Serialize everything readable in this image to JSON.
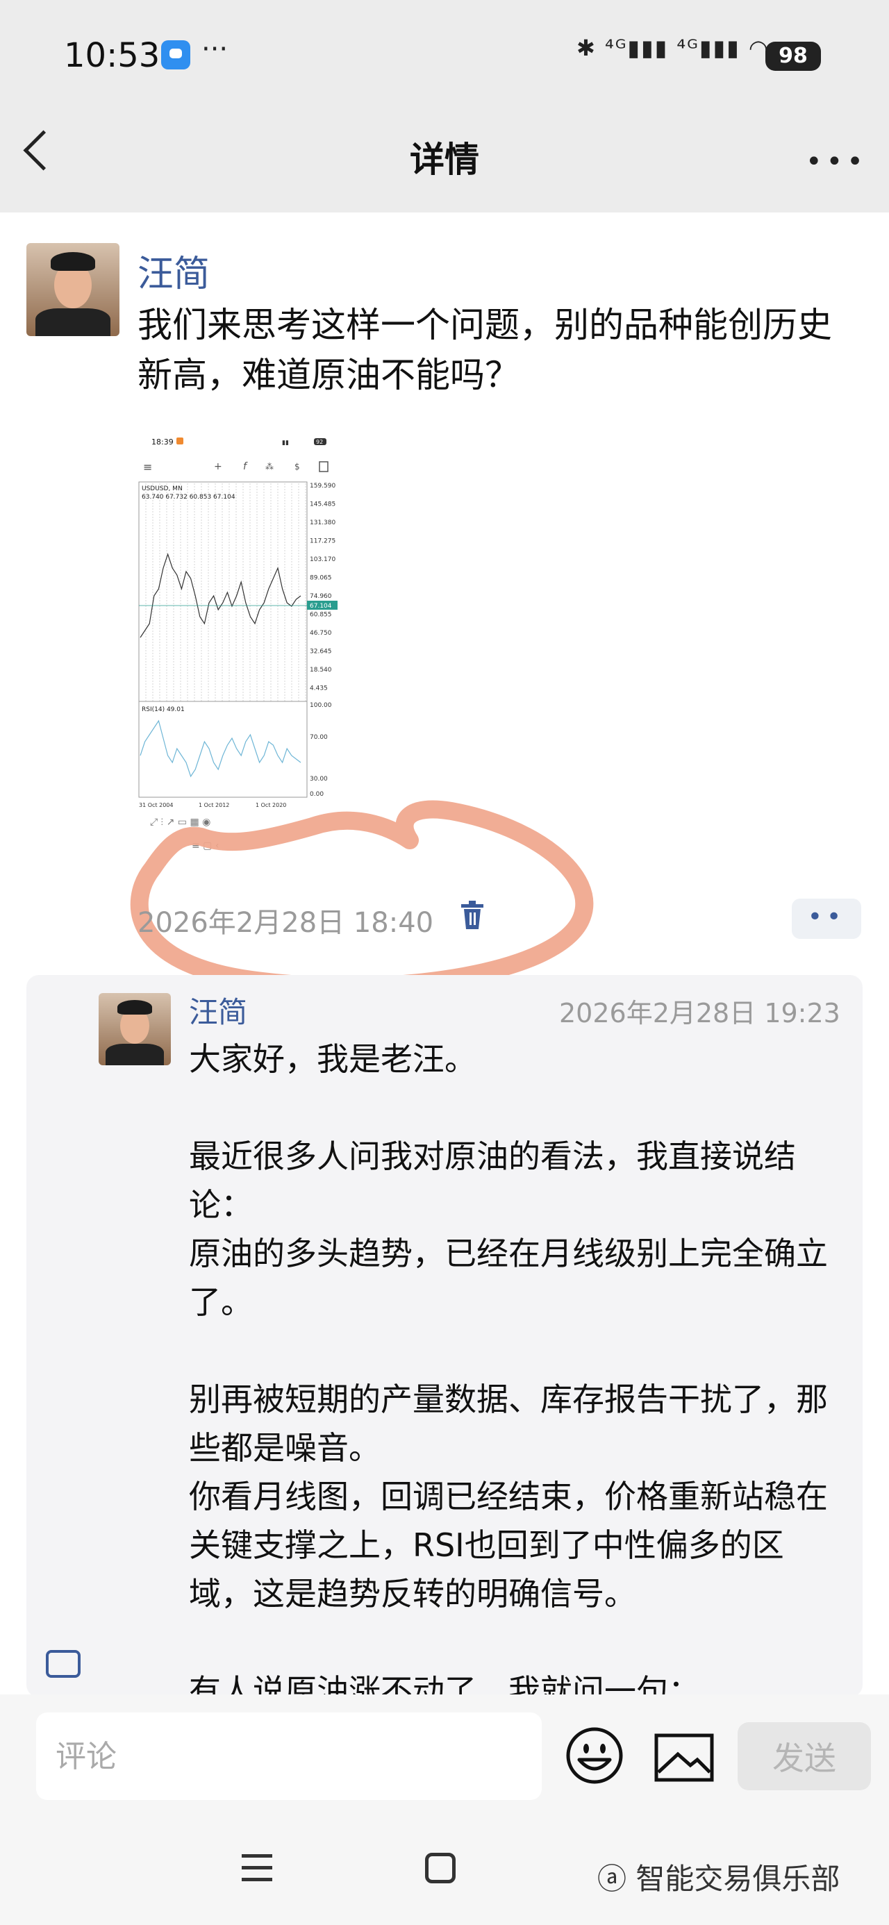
{
  "status_bar": {
    "time": "10:53",
    "more": "···",
    "icons": "✱ ⁴ᴳ▮▮▮ ⁴ᴳ▮▮▮ ◠",
    "battery": "98"
  },
  "header": {
    "title": "详情",
    "more": "•••"
  },
  "post": {
    "author": "汪简",
    "text": "我们来思考这样一个问题，别的品种能创历史新高，难道原油不能吗？",
    "date": "2026年2月28日 18:40",
    "menu": "••"
  },
  "chart_shot": {
    "time": "18:39",
    "battery": "92",
    "symbol": "USDUSD, MN",
    "ohlc": "63.740 67.732 60.853 67.104",
    "price_ticks": [
      "159.590",
      "145.485",
      "131.380",
      "117.275",
      "103.170",
      "89.065",
      "74.960",
      "60.855",
      "46.750",
      "32.645",
      "18.540",
      "4.435"
    ],
    "last_price": "67.104",
    "rsi_label": "RSI(14) 49.01",
    "rsi_ticks": [
      "100.00",
      "70.00",
      "30.00",
      "0.00"
    ],
    "date_ticks": [
      "31 Oct 2004",
      "1 Oct 2012",
      "1 Oct 2020"
    ]
  },
  "comment": {
    "author": "汪简",
    "date": "2026年2月28日 19:23",
    "paragraphs": [
      "大家好，我是老汪。",
      "",
      "最近很多人问我对原油的看法，我直接说结论：",
      "原油的多头趋势，已经在月线级别上完全确立了。",
      "",
      "别再被短期的产量数据、库存报告干扰了，那些都是噪音。",
      "你看月线图，回调已经结束，价格重新站稳在关键支撑之上，RSI也回到了中性偏多的区域，这是趋势反转的明确信号。",
      "",
      "有人说原油涨不动了，我就问一句："
    ]
  },
  "input": {
    "placeholder": "评论",
    "send": "发送"
  },
  "watermark": "智能交易俱乐部"
}
